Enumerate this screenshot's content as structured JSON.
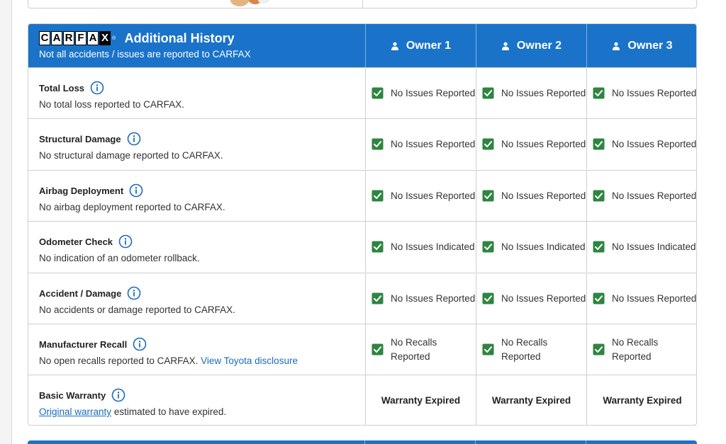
{
  "header": {
    "logo_text": "CARFAX",
    "title": "Additional History",
    "subtitle": "Not all accidents / issues are reported to CARFAX",
    "owners": [
      "Owner 1",
      "Owner 2",
      "Owner 3"
    ]
  },
  "colors": {
    "header_bg": "#1a73c9",
    "check_green": "#2e8540",
    "link_blue": "#1a6bbf"
  },
  "rows": [
    {
      "title": "Total Loss",
      "desc": "No total loss reported to CARFAX.",
      "status": [
        "No Issues Reported",
        "No Issues Reported",
        "No Issues Reported"
      ]
    },
    {
      "title": "Structural Damage",
      "desc": "No structural damage reported to CARFAX.",
      "status": [
        "No Issues Reported",
        "No Issues Reported",
        "No Issues Reported"
      ]
    },
    {
      "title": "Airbag Deployment",
      "desc": "No airbag deployment reported to CARFAX.",
      "status": [
        "No Issues Reported",
        "No Issues Reported",
        "No Issues Reported"
      ]
    },
    {
      "title": "Odometer Check",
      "desc": "No indication of an odometer rollback.",
      "status": [
        "No Issues Indicated",
        "No Issues Indicated",
        "No Issues Indicated"
      ]
    },
    {
      "title": "Accident / Damage",
      "desc": "No accidents or damage reported to CARFAX.",
      "status": [
        "No Issues Reported",
        "No Issues Reported",
        "No Issues Reported"
      ]
    },
    {
      "title": "Manufacturer Recall",
      "desc": "No open recalls reported to CARFAX.",
      "link": "View Toyota disclosure",
      "status": [
        "No Recalls Reported",
        "No Recalls Reported",
        "No Recalls Reported"
      ]
    },
    {
      "title": "Basic Warranty",
      "link": "Original warranty",
      "desc": "estimated to have expired.",
      "status": [
        "Warranty Expired",
        "Warranty Expired",
        "Warranty Expired"
      ]
    }
  ],
  "icons": {
    "owner": "person-icon",
    "info": "info-icon",
    "check": "checkbox-checked-icon"
  }
}
